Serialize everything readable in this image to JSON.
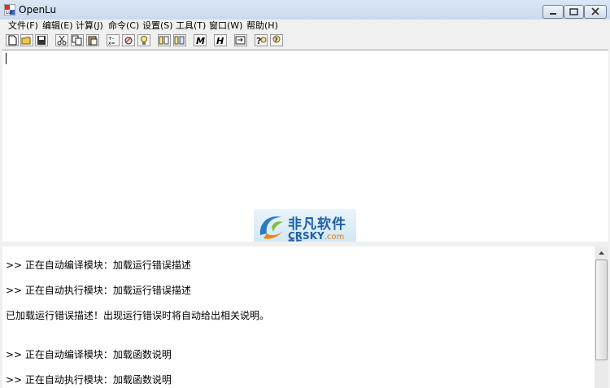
{
  "window": {
    "title": "OpenLu"
  },
  "menu": [
    "文件(F)",
    "编辑(E)",
    "计算(J)",
    "命令(C)",
    "设置(S)",
    "工具(T)",
    "窗口(W)",
    "帮助(H)"
  ],
  "toolbar": {
    "buttons": [
      {
        "name": "new-file-icon"
      },
      {
        "name": "open-folder-icon"
      },
      {
        "name": "save-icon"
      },
      {
        "name": "cut-icon"
      },
      {
        "name": "copy-icon"
      },
      {
        "name": "paste-icon"
      },
      {
        "name": "calculate-icon"
      },
      {
        "name": "execute-icon"
      },
      {
        "name": "light-bulb-icon"
      },
      {
        "name": "module-icon-1"
      },
      {
        "name": "module-icon-2"
      },
      {
        "name": "italic-m-icon",
        "glyph": "M"
      },
      {
        "name": "italic-h-icon",
        "glyph": "H"
      },
      {
        "name": "export-icon"
      },
      {
        "name": "help-icon"
      },
      {
        "name": "help-context-icon"
      }
    ]
  },
  "output": {
    "lines": [
      ">> 正在自动编译模块：加载运行错误描述",
      ">> 正在自动执行模块：加载运行错误描述",
      "已加载运行错误描述！出现运行错误时将自动给出相关说明。",
      ">> 正在自动编译模块：加载函数说明",
      ">> 正在自动执行模块：加载函数说明"
    ]
  },
  "watermark": {
    "cn": "非凡软件站",
    "en": "CRSKY",
    "en_suffix": ".com"
  },
  "colors": {
    "titlebar": "#c9d9ee",
    "watermark_blue": "#1d5fa6",
    "watermark_orange": "#e07a12"
  }
}
